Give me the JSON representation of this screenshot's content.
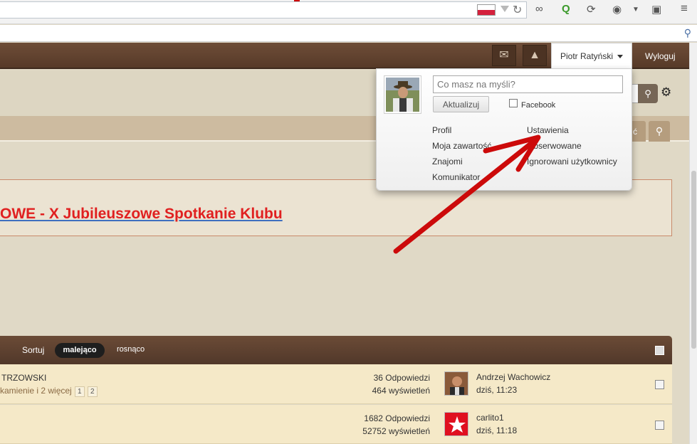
{
  "browser": {
    "search_icon": "search-icon",
    "flag_colors": [
      "#ffffff",
      "#d4213d"
    ]
  },
  "site": {
    "user_menu_label": "Piotr Ratyński",
    "logout_label": "Wyloguj",
    "accent_brown": "#5e3f2b"
  },
  "popup": {
    "status_placeholder": "Co masz na myśli?",
    "update_button": "Aktualizuj",
    "facebook_label": "Facebook",
    "links_left": [
      "Profil",
      "Moja zawartość",
      "Znajomi",
      "Komunikator"
    ],
    "links_right": [
      "Ustawienia",
      "Obserwowane",
      "Ignorowani użytkownicy"
    ]
  },
  "thread": {
    "title": "OWE - X Jubileuszowe Spotkanie Klubu"
  },
  "list": {
    "sort_label": "Sortuj",
    "sort_desc": "malejąco",
    "sort_asc": "rosnąco",
    "rows": [
      {
        "name": "TRZOWSKI",
        "sub": "kamienie i 2 więcej",
        "pages": [
          "1",
          "2"
        ],
        "replies": "36 Odpowiedzi",
        "views": "464 wyświetleń",
        "user": "Andrzej Wachowicz",
        "when": "dziś, 11:23"
      },
      {
        "name": "",
        "sub": "",
        "pages": [],
        "replies": "1682 Odpowiedzi",
        "views": "52752 wyświetleń",
        "user": "carlito1",
        "when": "dziś, 11:18"
      }
    ]
  }
}
